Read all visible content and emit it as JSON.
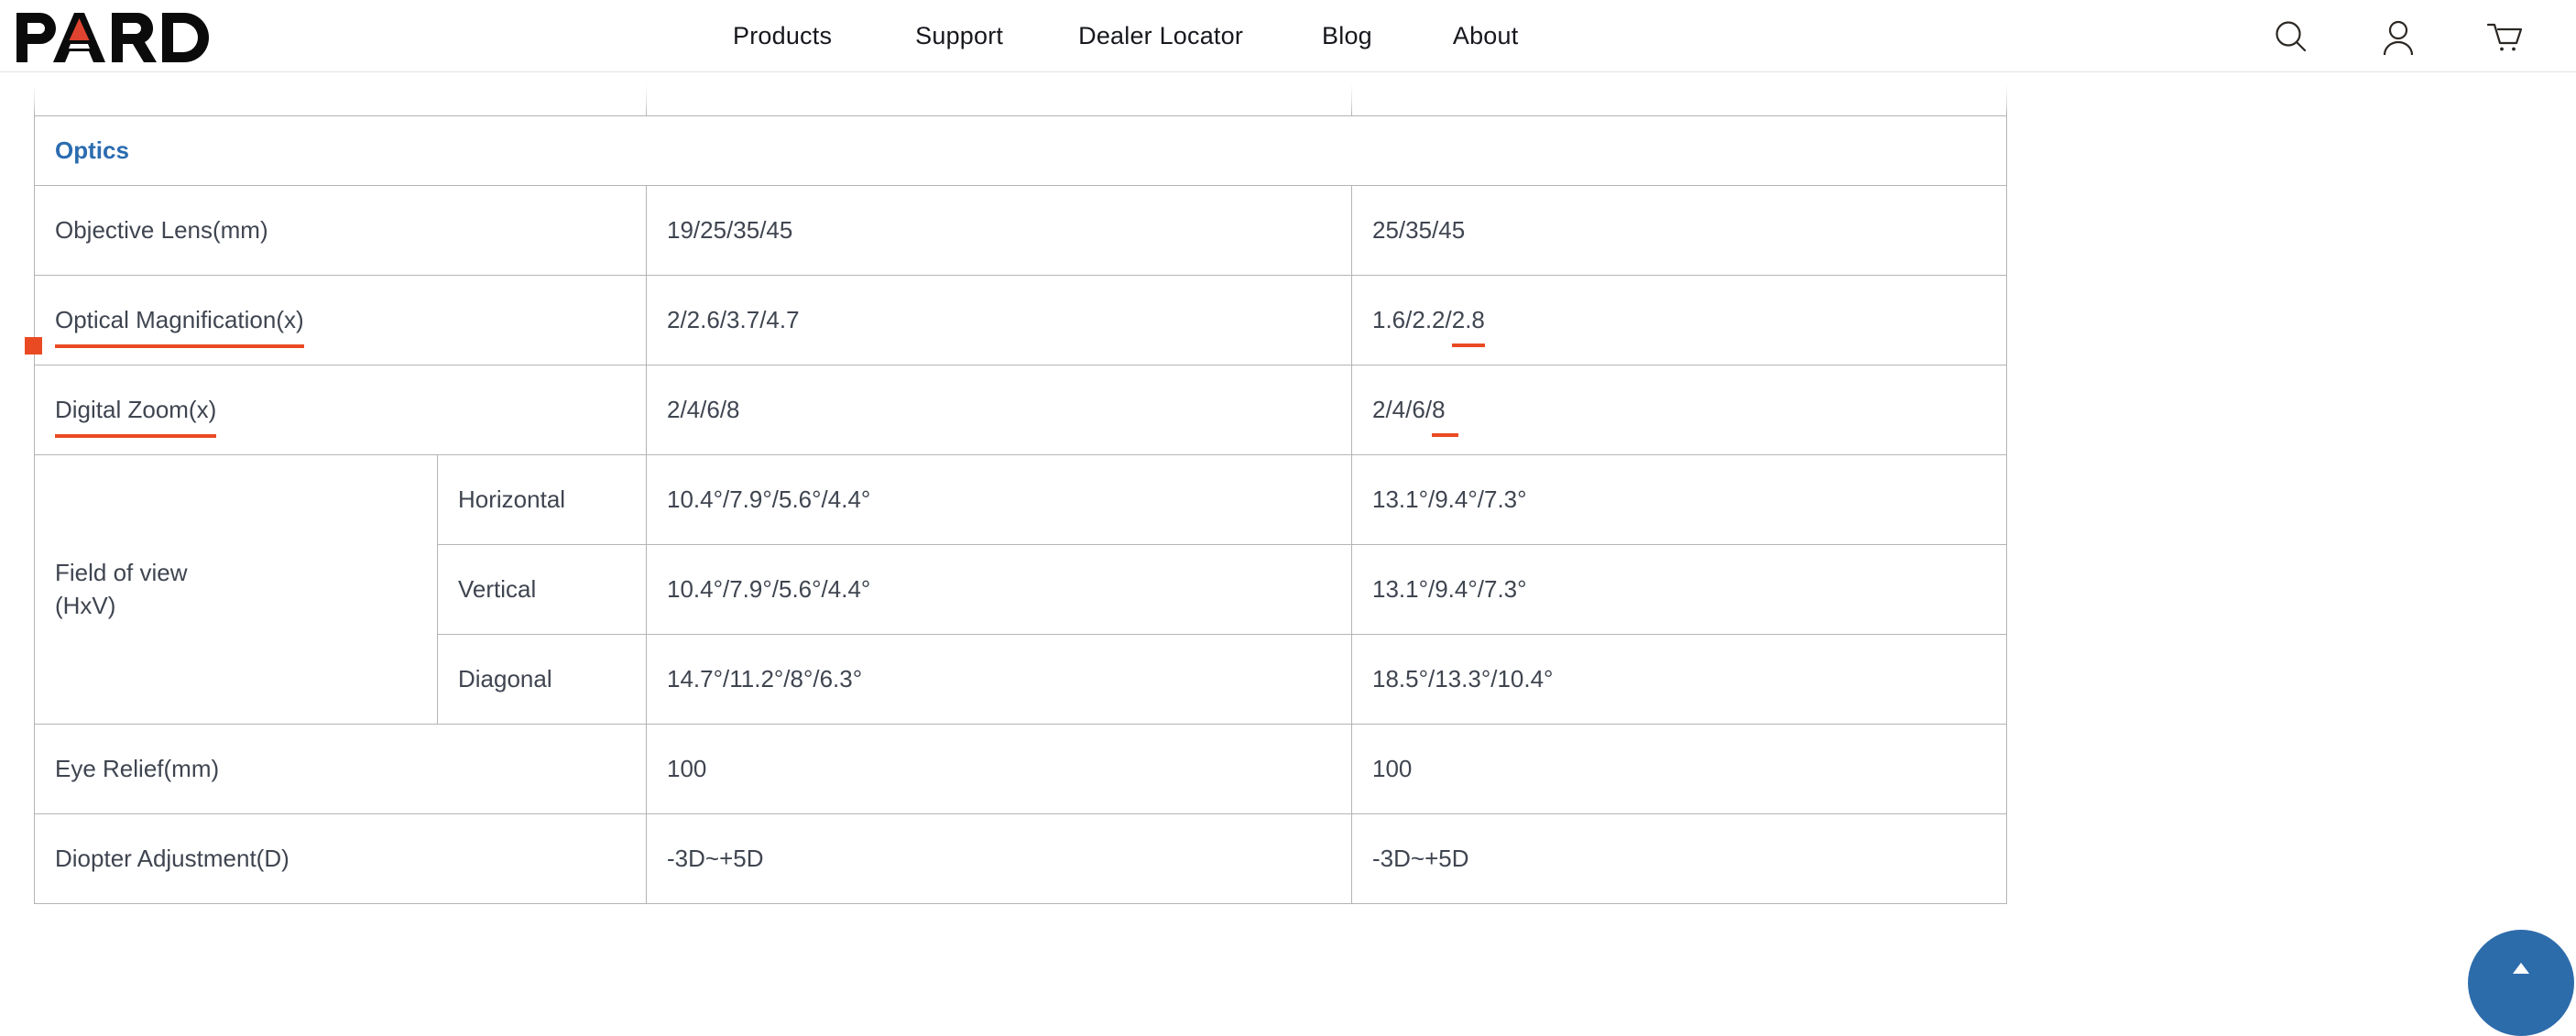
{
  "header": {
    "logo_text": "PARD",
    "logo_accent_color": "#e0432f",
    "nav": [
      {
        "label": "Products"
      },
      {
        "label": "Support"
      },
      {
        "label": "Dealer Locator"
      },
      {
        "label": "Blog"
      },
      {
        "label": "About"
      }
    ],
    "icons": [
      {
        "name": "search-icon",
        "label": "Search"
      },
      {
        "name": "account-icon",
        "label": "Account"
      },
      {
        "name": "cart-icon",
        "label": "Cart"
      }
    ]
  },
  "spec_table": {
    "section_title": "Optics",
    "annotation_color": "#ea4a23",
    "section_color": "#2a6cb0",
    "rows": [
      {
        "type": "partial",
        "label": "",
        "col_a": "",
        "col_b": ""
      },
      {
        "type": "section",
        "label": "Optics"
      },
      {
        "type": "standard",
        "label": "Objective Lens(mm)",
        "col_a": "19/25/35/45",
        "col_b": "25/35/45"
      },
      {
        "type": "standard",
        "label": "Optical Magnification(x)",
        "col_a": "2/2.6/3.7/4.7",
        "col_b_plain": "1.6/2.2/",
        "col_b_marked": "2.8"
      },
      {
        "type": "standard",
        "label": "Digital Zoom(x)",
        "col_a": "2/4/6/8",
        "col_b_plain": "2/4/6/",
        "col_b_marked": "8"
      },
      {
        "type": "fov",
        "label": "Field of view (HxV)",
        "label_line1": "Field of view",
        "label_line2": "(HxV)",
        "sub_rows": [
          {
            "sub": "Horizontal",
            "col_a": "10.4°/7.9°/5.6°/4.4°",
            "col_b": "13.1°/9.4°/7.3°"
          },
          {
            "sub": "Vertical",
            "col_a": "10.4°/7.9°/5.6°/4.4°",
            "col_b": "13.1°/9.4°/7.3°"
          },
          {
            "sub": "Diagonal",
            "col_a": "14.7°/11.2°/8°/6.3°",
            "col_b": "18.5°/13.3°/10.4°"
          }
        ]
      },
      {
        "type": "standard",
        "label": "Eye Relief(mm)",
        "col_a": "100",
        "col_b": "100"
      },
      {
        "type": "standard",
        "label": "Diopter Adjustment(D)",
        "col_a": "-3D~+5D",
        "col_b": "-3D~+5D"
      }
    ]
  },
  "fab": {
    "name": "scroll-to-top-button",
    "color": "#2d6cab"
  }
}
